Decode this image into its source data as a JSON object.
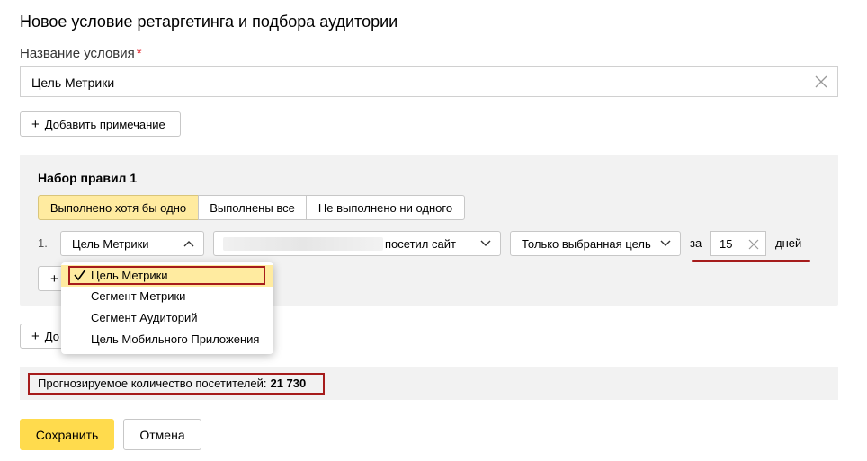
{
  "page": {
    "title": "Новое условие ретаргетинга и подбора аудитории"
  },
  "name_field": {
    "label": "Название условия",
    "required_mark": "*",
    "value": "Цель Метрики"
  },
  "add_note_button": {
    "plus": "+",
    "label": "Добавить примечание"
  },
  "ruleset": {
    "title": "Набор правил 1",
    "mode_tabs": [
      {
        "label": "Выполнено хотя бы одно",
        "selected": true
      },
      {
        "label": "Выполнены все",
        "selected": false
      },
      {
        "label": "Не выполнено ни одного",
        "selected": false
      }
    ],
    "rule": {
      "number": "1.",
      "type_value": "Цель Метрики",
      "goal_value": "посетил сайт",
      "scope_value": "Только выбранная цель",
      "za_label": "за",
      "days_value": "15",
      "days_label": "дней"
    },
    "add_rule_plus": "+"
  },
  "type_dropdown": {
    "options": [
      {
        "label": "Цель Метрики",
        "selected": true
      },
      {
        "label": "Сегмент Метрики",
        "selected": false
      },
      {
        "label": "Сегмент Аудиторий",
        "selected": false
      },
      {
        "label": "Цель Мобильного Приложения",
        "selected": false
      }
    ]
  },
  "add_set_button": {
    "plus": "+",
    "label_visible": "До"
  },
  "forecast": {
    "label": "Прогнозируемое количество посетителей:",
    "value": "21 730"
  },
  "footer": {
    "save_label": "Сохранить",
    "cancel_label": "Отмена"
  },
  "colors": {
    "accent_yellow": "#ffdb4d",
    "selected_tab": "#ffeba0",
    "annotation_red": "#a61c1c",
    "panel_gray": "#f2f2f2"
  }
}
